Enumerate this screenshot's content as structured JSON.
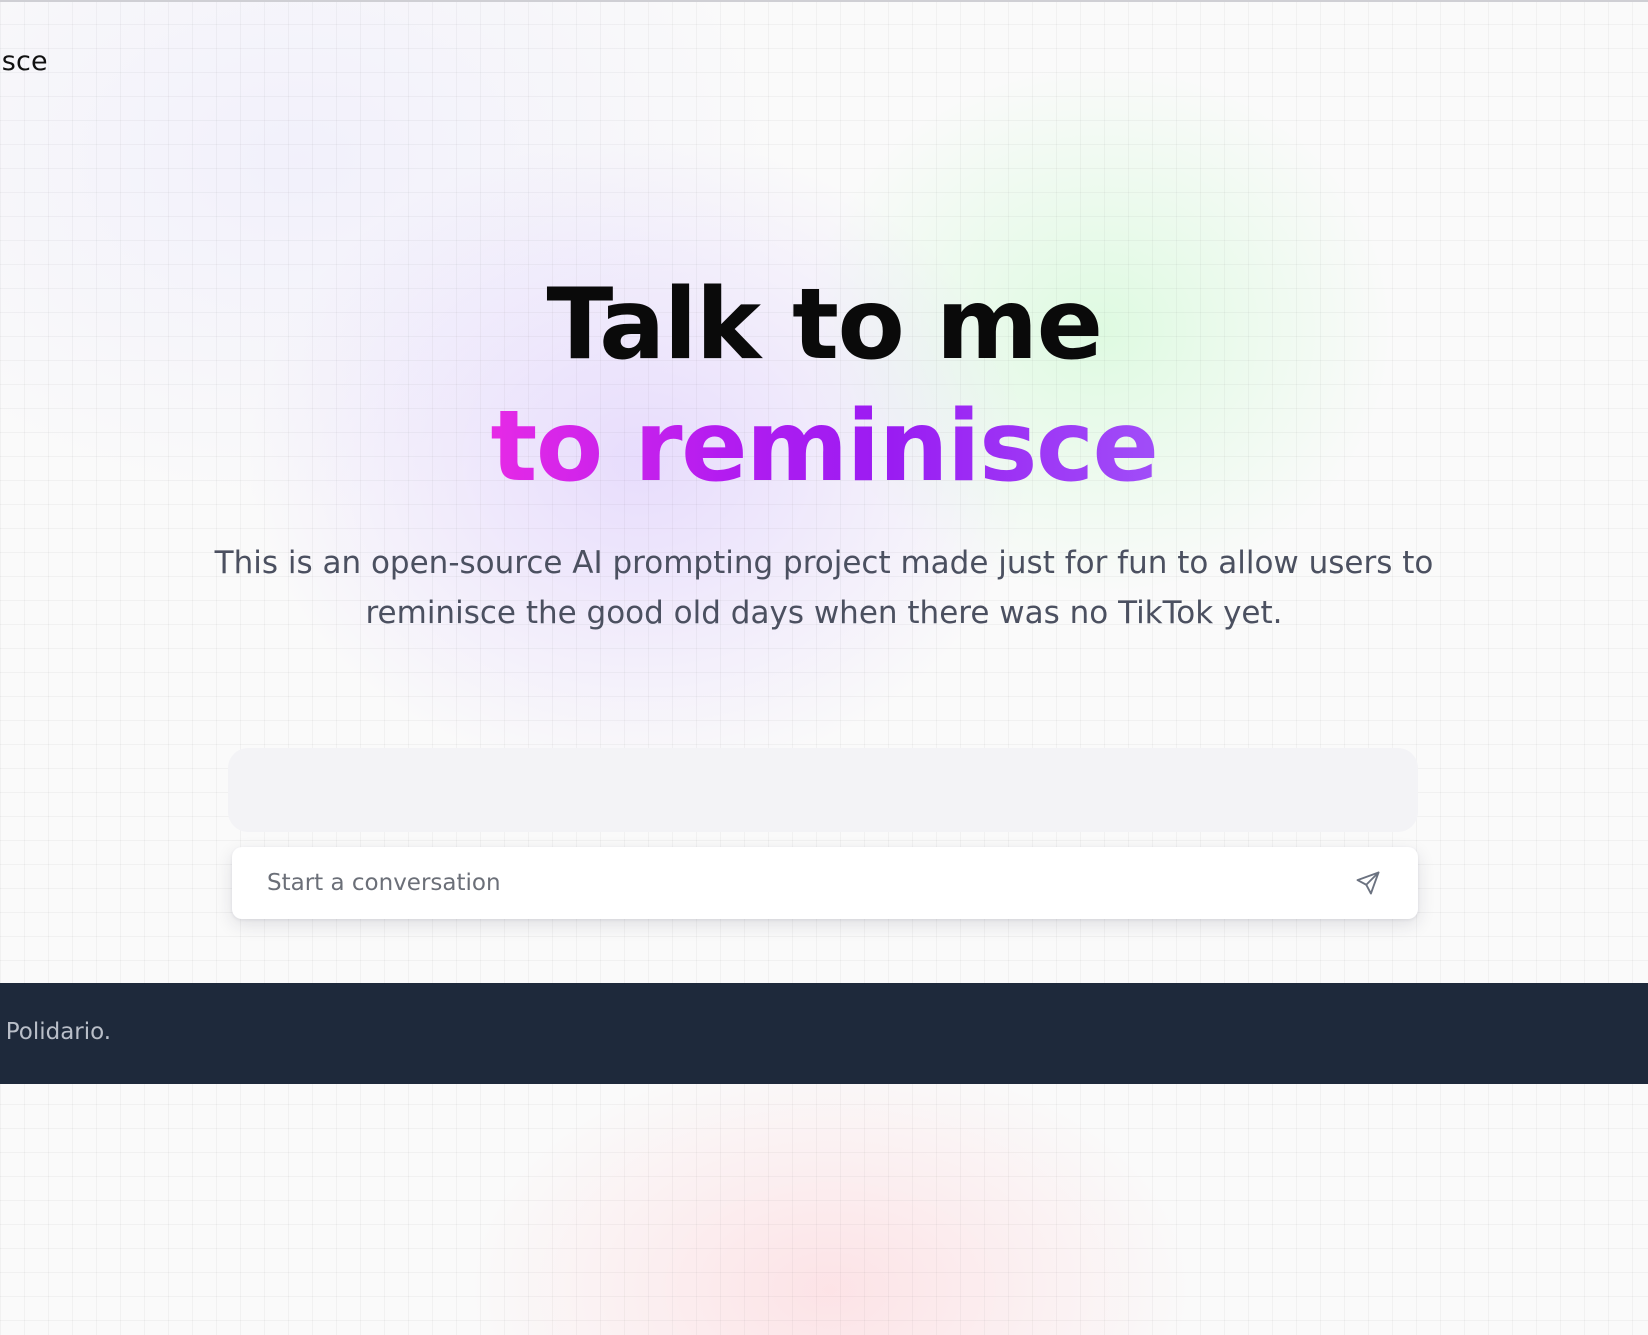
{
  "header": {
    "brand": "isce"
  },
  "hero": {
    "title": "Talk to me",
    "subtitle": "to reminisce",
    "subtitle_gradient": [
      "#e62ae6",
      "#b31cf0",
      "#9a1cf2",
      "#a04ef8"
    ]
  },
  "description": "This is an open-source AI prompting project made just for fun to allow users to reminisce the good old days when there was no TikTok yet.",
  "chat": {
    "placeholder": "Start a conversation",
    "value": "",
    "send_icon": "paper-plane-icon"
  },
  "footer": {
    "text": "l Polidario.",
    "background": "#1e293b"
  }
}
